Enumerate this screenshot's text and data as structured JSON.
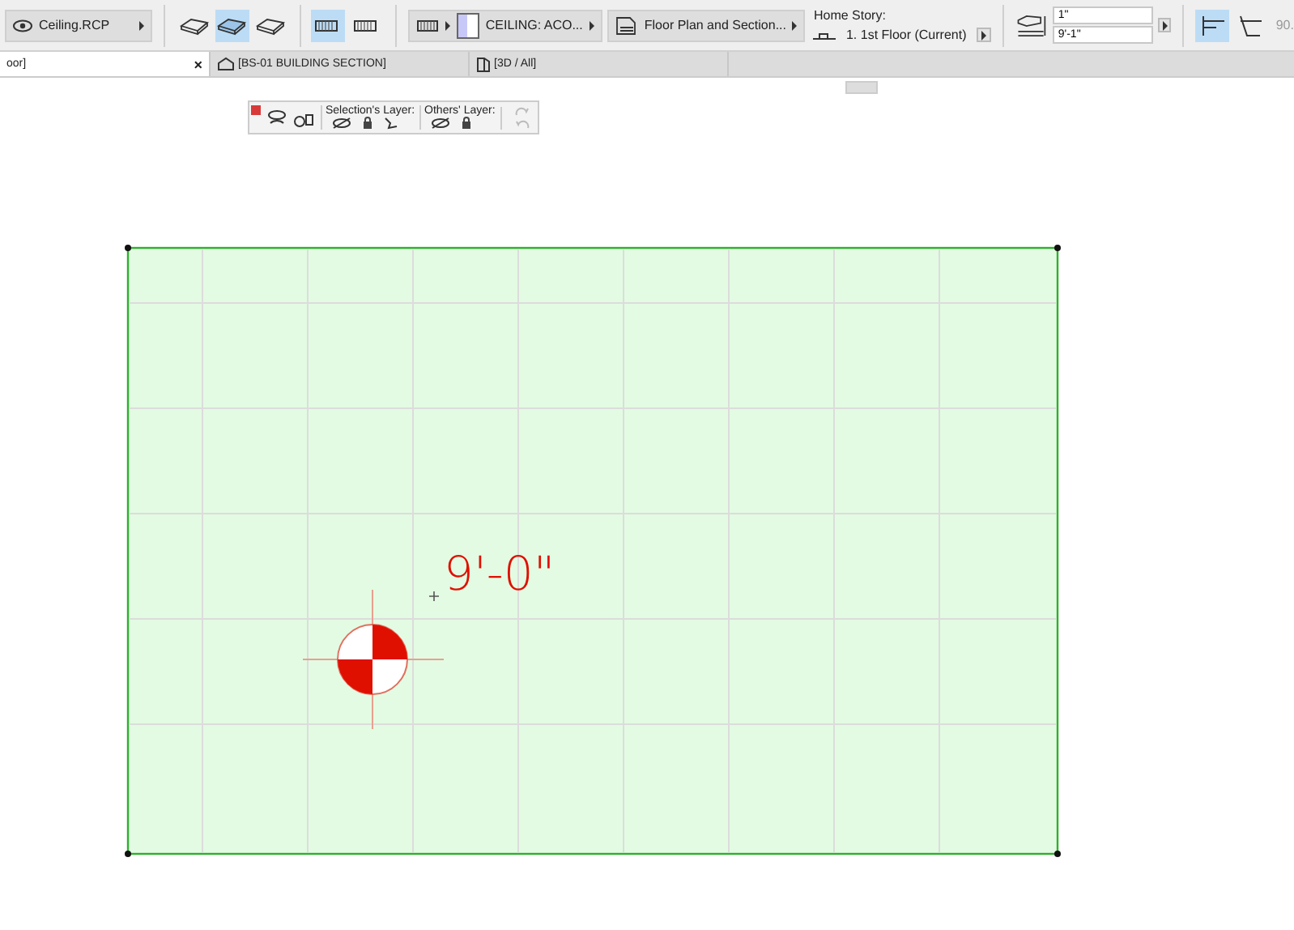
{
  "toolbar": {
    "layer_combo": "Ceiling.RCP",
    "view_buttons": [
      {
        "selected": false
      },
      {
        "selected": true
      },
      {
        "selected": false
      }
    ],
    "fill_buttons": [
      {
        "selected": true
      },
      {
        "selected": false
      }
    ],
    "surface_combo": "CEILING: ACO...",
    "view_combo": "Floor Plan and Section...",
    "home_story": {
      "label": "Home Story:",
      "value": "1. 1st Floor (Current)"
    },
    "height_fields": [
      "1\"",
      "9'-1\""
    ],
    "mode_buttons": [
      {
        "selected": true
      },
      {
        "selected": false
      }
    ],
    "angle_field": "90."
  },
  "tabs": [
    {
      "label": "oor]",
      "selected": true,
      "close": "×"
    },
    {
      "label": "[BS-01 BUILDING SECTION]",
      "selected": false
    },
    {
      "label": "[3D / All]",
      "selected": false
    }
  ],
  "layer_palette": {
    "selection_label": "Selection's Layer:",
    "others_label": "Others' Layer:"
  },
  "canvas": {
    "elevation_text": "9'-0\""
  }
}
